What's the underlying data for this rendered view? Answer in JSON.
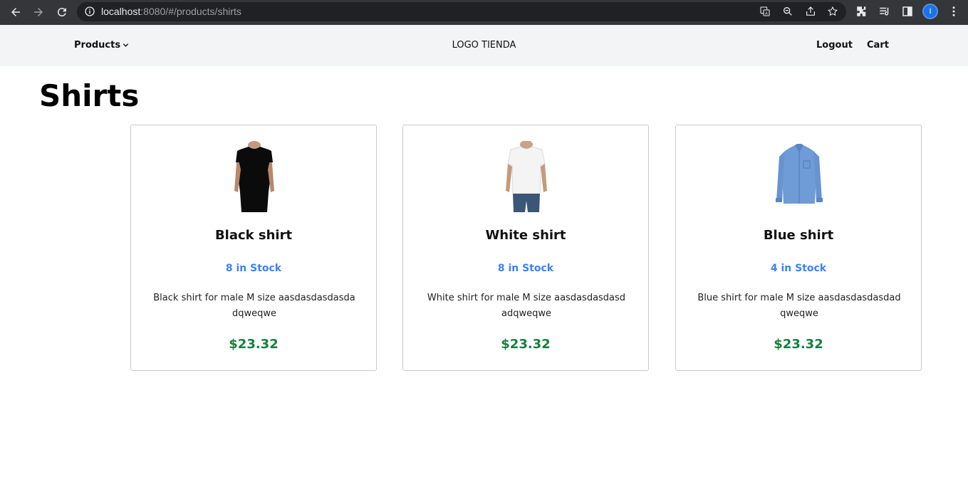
{
  "browser": {
    "url_host": "localhost",
    "url_rest": ":8080/#/products/shirts",
    "profile_initial": "I"
  },
  "header": {
    "products_label": "Products",
    "logo_text": "LOGO TIENDA",
    "logout_label": "Logout",
    "cart_label": "Cart"
  },
  "page": {
    "title": "Shirts"
  },
  "colors": {
    "stock": "#3b82f6",
    "price": "#15803d",
    "header_bg": "#f3f4f6"
  },
  "products": [
    {
      "name": "Black shirt",
      "stock": "8 in Stock",
      "description": "Black shirt for male M size aasdasdasdasdadqweqwe",
      "price": "$23.32",
      "image": "black-tshirt-photo"
    },
    {
      "name": "White shirt",
      "stock": "8 in Stock",
      "description": "White shirt for male M size aasdasdasdasdadqweqwe",
      "price": "$23.32",
      "image": "white-tshirt-photo"
    },
    {
      "name": "Blue shirt",
      "stock": "4 in Stock",
      "description": "Blue shirt for male M size aasdasdasdasdadqweqwe",
      "price": "$23.32",
      "image": "blue-dress-shirt-photo"
    }
  ]
}
